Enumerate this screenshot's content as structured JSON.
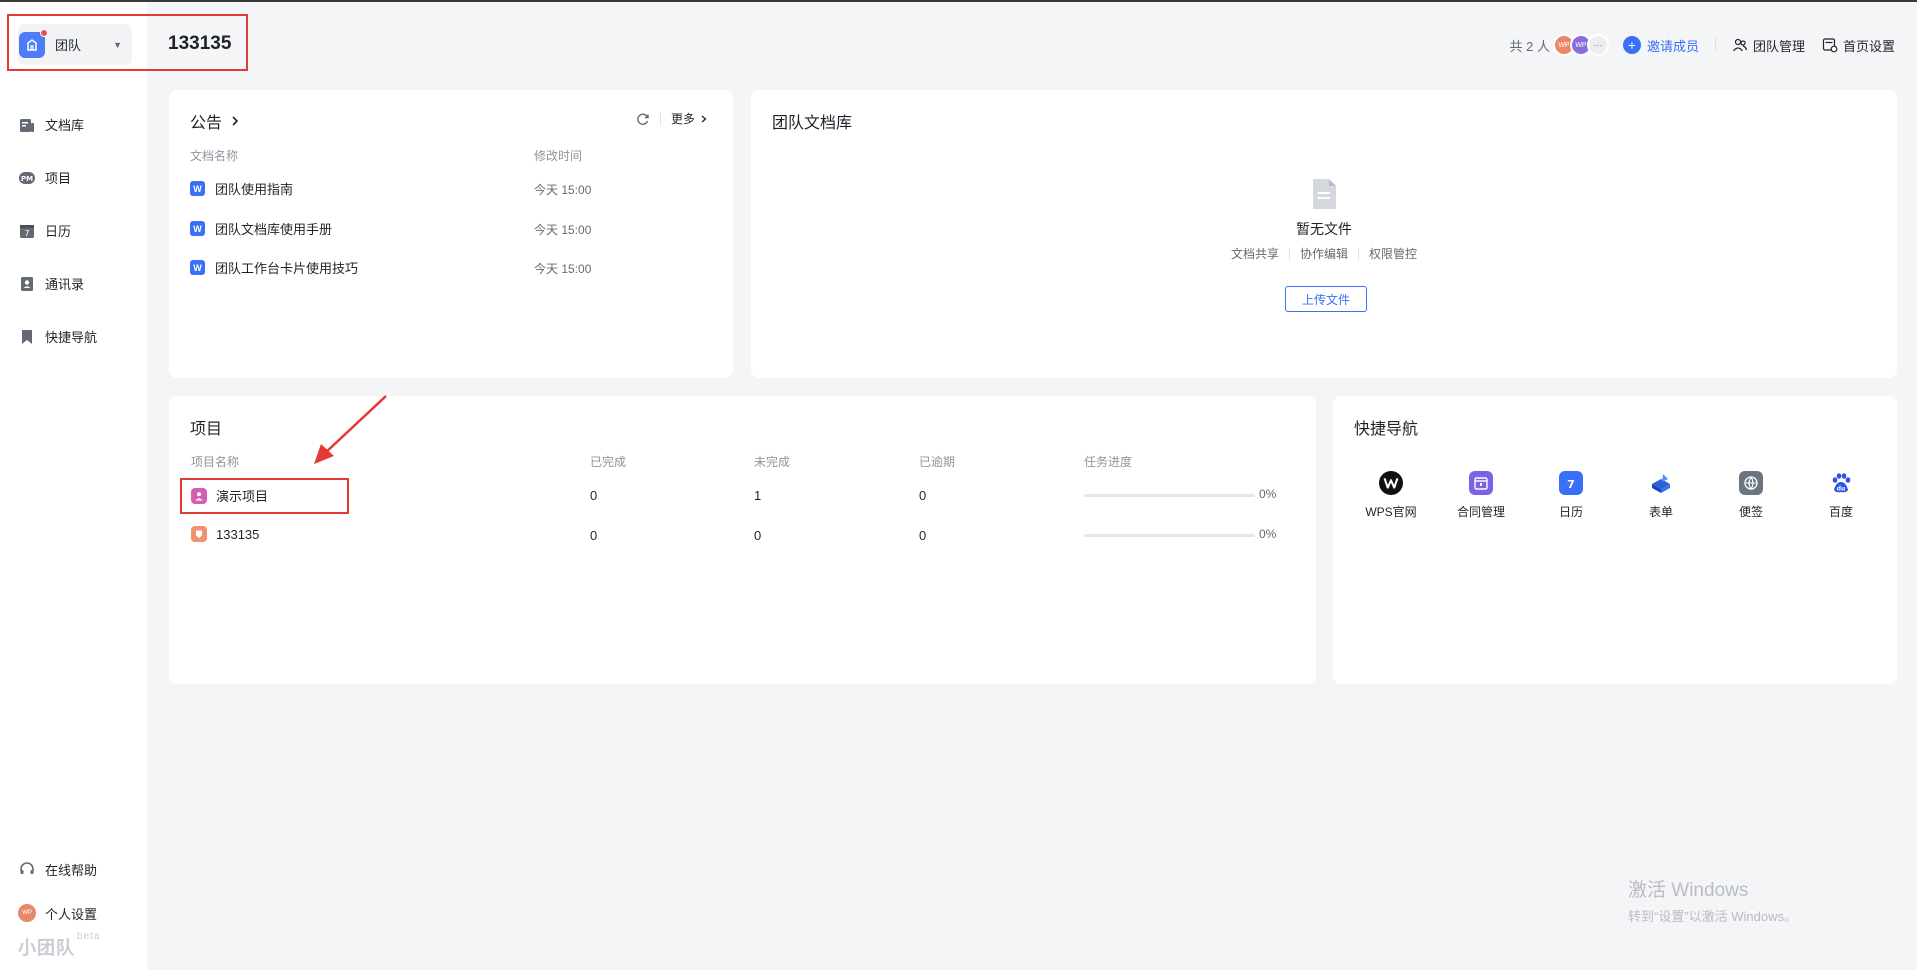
{
  "header": {
    "team_switch_label": "团队",
    "team_title": "133135",
    "member_count": "共 2 人",
    "avatar_initials": [
      "WP",
      "WP"
    ],
    "more_members": "···",
    "invite_label": "邀请成员",
    "team_manage_label": "团队管理",
    "home_settings_label": "首页设置"
  },
  "sidebar": {
    "items": [
      {
        "label": "文档库",
        "icon": "doc-library-icon"
      },
      {
        "label": "项目",
        "icon": "pm-project-icon"
      },
      {
        "label": "日历",
        "icon": "calendar-icon"
      },
      {
        "label": "通讯录",
        "icon": "contacts-icon"
      },
      {
        "label": "快捷导航",
        "icon": "bookmark-icon"
      }
    ],
    "help_label": "在线帮助",
    "personal_settings_label": "个人设置",
    "user_avatar_initials": "WP",
    "brand": "小团队",
    "brand_tag": "beta"
  },
  "announcement": {
    "title": "公告",
    "more_label": "更多",
    "col_name": "文档名称",
    "col_time": "修改时间",
    "rows": [
      {
        "name": "团队使用指南",
        "time": "今天 15:00"
      },
      {
        "name": "团队文档库使用手册",
        "time": "今天 15:00"
      },
      {
        "name": "团队工作台卡片使用技巧",
        "time": "今天 15:00"
      }
    ]
  },
  "doc_library": {
    "title": "团队文档库",
    "empty_title": "暂无文件",
    "features": [
      "文档共享",
      "协作编辑",
      "权限管控"
    ],
    "upload_label": "上传文件"
  },
  "projects": {
    "title": "项目",
    "columns": [
      "项目名称",
      "已完成",
      "未完成",
      "已逾期",
      "任务进度"
    ],
    "rows": [
      {
        "name": "演示项目",
        "done": "0",
        "undone": "1",
        "overdue": "0",
        "progress_label": "0%",
        "progress": 0,
        "icon_color": "#d45fb4"
      },
      {
        "name": "133135",
        "done": "0",
        "undone": "0",
        "overdue": "0",
        "progress_label": "0%",
        "progress": 0,
        "icon_color": "#f3906f"
      }
    ]
  },
  "quick_nav": {
    "title": "快捷导航",
    "items": [
      {
        "label": "WPS官网",
        "icon": "wps-logo-icon"
      },
      {
        "label": "合同管理",
        "icon": "contract-icon"
      },
      {
        "label": "日历",
        "icon": "calendar-7-icon"
      },
      {
        "label": "表单",
        "icon": "form-icon"
      },
      {
        "label": "便签",
        "icon": "note-icon"
      },
      {
        "label": "百度",
        "icon": "baidu-paw-icon"
      }
    ]
  },
  "watermark": {
    "line1": "激活 Windows",
    "line2": "转到“设置”以激活 Windows。"
  },
  "colors": {
    "accent": "#3a6ff7",
    "annotation_red": "#e53935"
  }
}
